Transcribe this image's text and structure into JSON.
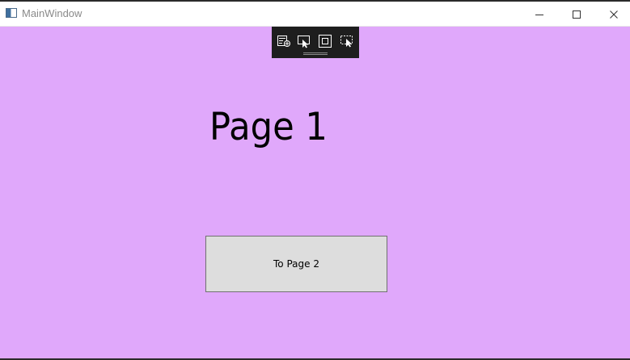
{
  "window": {
    "title": "MainWindow",
    "background": "#e0a8fb",
    "controls": {
      "minimize_icon": "minimize-icon",
      "maximize_icon": "maximize-icon",
      "close_icon": "close-icon"
    }
  },
  "debug_toolbar": {
    "icons": [
      "go-to-live-visual-tree-icon",
      "select-element-icon",
      "display-layout-adorners-icon",
      "track-focused-element-icon"
    ]
  },
  "page": {
    "heading": "Page 1",
    "button_label": "To Page 2"
  }
}
